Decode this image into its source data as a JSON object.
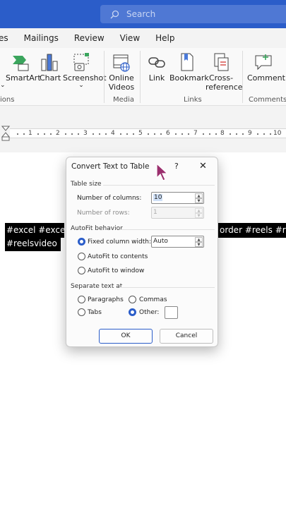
{
  "titlebar": {
    "search_placeholder": "Search"
  },
  "menu": {
    "tabs": [
      "es",
      "Mailings",
      "Review",
      "View",
      "Help"
    ]
  },
  "ribbon": {
    "smartart": "SmartArt",
    "chart": "Chart",
    "screenshot": "Screenshot",
    "online_videos_1": "Online",
    "online_videos_2": "Videos",
    "link": "Link",
    "bookmark": "Bookmark",
    "cross_ref_1": "Cross-",
    "cross_ref_2": "reference",
    "comment": "Comment",
    "groups": {
      "illustrations": "ions",
      "media": "Media",
      "links": "Links",
      "comments": "Comments"
    }
  },
  "ruler": {
    "numbers": [
      "1",
      "2",
      "3",
      "4",
      "5",
      "6",
      "7",
      "8",
      "9",
      "10"
    ]
  },
  "document": {
    "line1_left": "#excel #exceltu",
    "line1_right": "order #reels #ree",
    "line2": "#reelsvideo"
  },
  "dialog": {
    "title": "Convert Text to Table",
    "help": "?",
    "close": "✕",
    "table_size": "Table size",
    "num_columns_label": "Number of columns:",
    "num_columns_value": "10",
    "num_rows_label": "Number of rows:",
    "num_rows_value": "1",
    "autofit": "AutoFit behavior",
    "fixed_width_label": "Fixed column width:",
    "fixed_width_value": "Auto",
    "autofit_contents": "AutoFit to contents",
    "autofit_window": "AutoFit to window",
    "separate": "Separate text at",
    "paragraphs": "Paragraphs",
    "commas": "Commas",
    "tabs": "Tabs",
    "other": "Other:",
    "ok": "OK",
    "cancel": "Cancel"
  },
  "colors": {
    "accent": "#2b5dc9",
    "highlight": "#000000",
    "cursor": "#9b2f6e"
  }
}
